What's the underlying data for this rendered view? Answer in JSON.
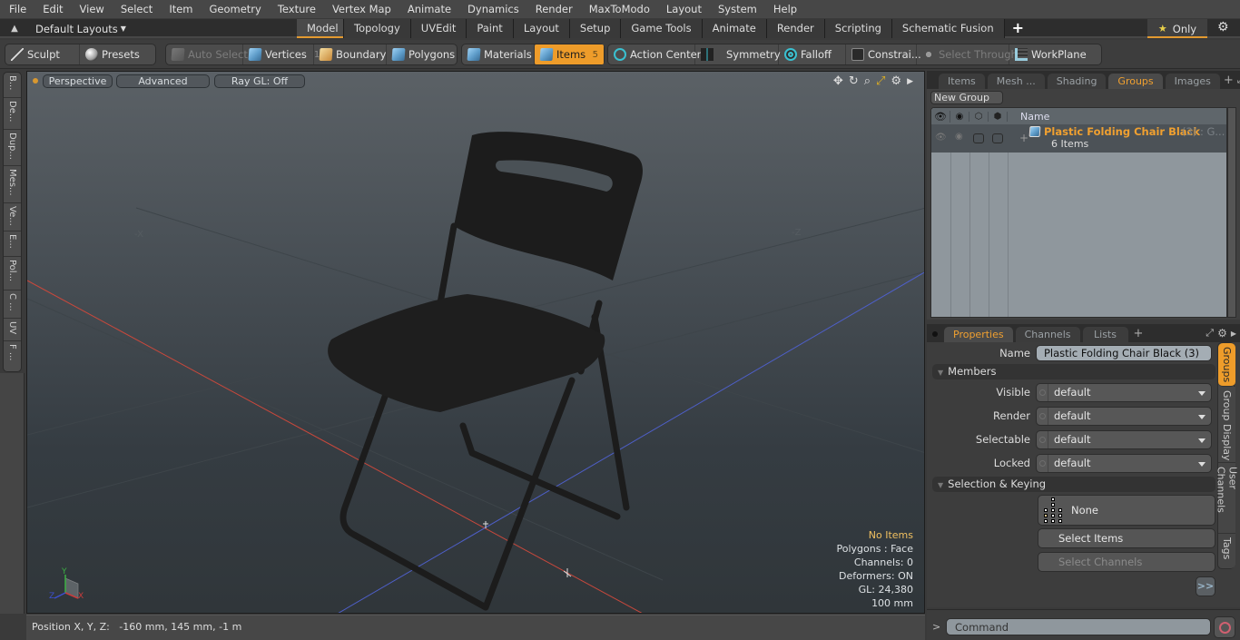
{
  "menubar": {
    "items": [
      "File",
      "Edit",
      "View",
      "Select",
      "Item",
      "Geometry",
      "Texture",
      "Vertex Map",
      "Animate",
      "Dynamics",
      "Render",
      "MaxToModo",
      "Layout",
      "System",
      "Help"
    ]
  },
  "layoutbar": {
    "layouts_label": "Default Layouts",
    "tabs": [
      "Model",
      "Topology",
      "UVEdit",
      "Paint",
      "Layout",
      "Setup",
      "Game Tools",
      "Animate",
      "Render",
      "Scripting",
      "Schematic Fusion"
    ],
    "active_tab": "Model",
    "add_tab": "+",
    "only_label": "Only"
  },
  "toolbar": {
    "sculpt": "Sculpt",
    "presets": "Presets",
    "auto_select": "Auto Select",
    "vertices": "Vertices",
    "vertices_count": "1",
    "boundary": "Boundary",
    "polygons": "Polygons",
    "materials": "Materials",
    "items": "Items",
    "items_count": "5",
    "action_center": "Action Center",
    "symmetry": "Symmetry",
    "falloff": "Falloff",
    "constraints": "Constrai...",
    "select_through": "Select Through",
    "workplane": "WorkPlane"
  },
  "left_tabs": [
    "B...",
    "De...",
    "Dup...",
    "Mes...",
    "Ve...",
    "E...",
    "Pol...",
    "C ...",
    "UV",
    "F ..."
  ],
  "viewport": {
    "perspective": "Perspective",
    "advanced": "Advanced",
    "raygl": "Ray GL: Off",
    "axis_label_x": "-X",
    "axis_label_z": "-Z",
    "gizmo_labels": {
      "x": "X",
      "y": "Y",
      "z": "Z"
    },
    "info": {
      "selection": "No Items",
      "mode": "Polygons : Face",
      "channels": "Channels: 0",
      "deformers": "Deformers: ON",
      "gl": "GL: 24,380",
      "scale": "100 mm"
    },
    "colors": {
      "x_axis": "#c8483c",
      "z_axis": "#4e5fc8",
      "info_highlight": "#f0c060"
    }
  },
  "statusbar": {
    "position": "Position X, Y, Z:   -160 mm, 145 mm, -1 m"
  },
  "items_panel": {
    "tabs": [
      "Items",
      "Mesh ...",
      "Shading",
      "Groups",
      "Images"
    ],
    "active_tab": "Groups",
    "new_group": "New Group",
    "column_name": "Name",
    "rows": [
      {
        "name": "Plastic Folding Chair Black",
        "suffix": "(3) : G...",
        "sub": "6 Items"
      }
    ]
  },
  "properties_panel": {
    "tabs": [
      "Properties",
      "Channels",
      "Lists"
    ],
    "active_tab": "Properties",
    "name_label": "Name",
    "name_value": "Plastic Folding Chair Black (3)",
    "members_section": "Members",
    "fields": [
      {
        "label": "Visible",
        "value": "default"
      },
      {
        "label": "Render",
        "value": "default"
      },
      {
        "label": "Selectable",
        "value": "default"
      },
      {
        "label": "Locked",
        "value": "default"
      }
    ],
    "selection_section": "Selection & Keying",
    "none_label": "None",
    "select_items": "Select Items",
    "select_channels": "Select Channels",
    "more": ">>",
    "side_tabs": [
      "Groups",
      "Group Display",
      "User Channels",
      "Tags"
    ],
    "active_side_tab": "Groups"
  },
  "command": {
    "prompt": ">",
    "placeholder": "Command"
  },
  "accent": "#ee9c2a"
}
